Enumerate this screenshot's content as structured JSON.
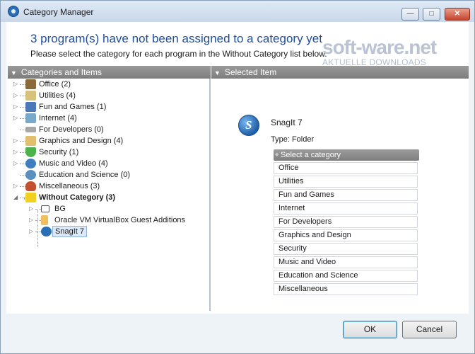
{
  "window": {
    "title": "Category Manager",
    "controls": {
      "minimize": "—",
      "maximize": "□",
      "close": "✕"
    }
  },
  "header": {
    "title": "3 program(s) have not been assigned to a category yet",
    "subtitle": "Please select the category for each program in the Without Category list below."
  },
  "watermark": {
    "logo": "soft-ware.net",
    "tagline": "AKTUELLE DOWNLOADS"
  },
  "left_pane": {
    "header": "Categories and Items",
    "tree": [
      {
        "label": "Office (2)",
        "icon": "office-icon",
        "expandable": true
      },
      {
        "label": "Utilities (4)",
        "icon": "utilities-icon",
        "expandable": true
      },
      {
        "label": "Fun and Games (1)",
        "icon": "games-icon",
        "expandable": true
      },
      {
        "label": "Internet (4)",
        "icon": "internet-icon",
        "expandable": true
      },
      {
        "label": "For Developers (0)",
        "icon": "developers-icon",
        "expandable": false
      },
      {
        "label": "Graphics and Design (4)",
        "icon": "graphics-icon",
        "expandable": true
      },
      {
        "label": "Security (1)",
        "icon": "security-icon",
        "expandable": true
      },
      {
        "label": "Music and Video (4)",
        "icon": "music-icon",
        "expandable": true
      },
      {
        "label": "Education and Science (0)",
        "icon": "education-icon",
        "expandable": false
      },
      {
        "label": "Miscellaneous (3)",
        "icon": "misc-icon",
        "expandable": true
      },
      {
        "label": "Without Category (3)",
        "icon": "without-category-icon",
        "expandable": true,
        "expanded": true,
        "bold": true
      }
    ],
    "children": [
      {
        "label": "BG",
        "icon": "folder-icon"
      },
      {
        "label": "Oracle VM VirtualBox Guest Additions",
        "icon": "folder-icon"
      },
      {
        "label": "SnagIt 7",
        "icon": "snagit-icon",
        "selected": true
      }
    ]
  },
  "right_pane": {
    "header": "Selected Item",
    "program_name": "SnagIt 7",
    "program_type": "Type: Folder",
    "category_prompt": "Select a category",
    "categories": [
      "Office",
      "Utilities",
      "Fun and Games",
      "Internet",
      "For Developers",
      "Graphics and Design",
      "Security",
      "Music and Video",
      "Education and Science",
      "Miscellaneous"
    ]
  },
  "footer": {
    "ok_label": "OK",
    "cancel_label": "Cancel"
  },
  "colors": {
    "title_blue": "#1e4f9c",
    "pane_header_gray": "#8a8a8a",
    "window_bg": "#eef3f8"
  }
}
